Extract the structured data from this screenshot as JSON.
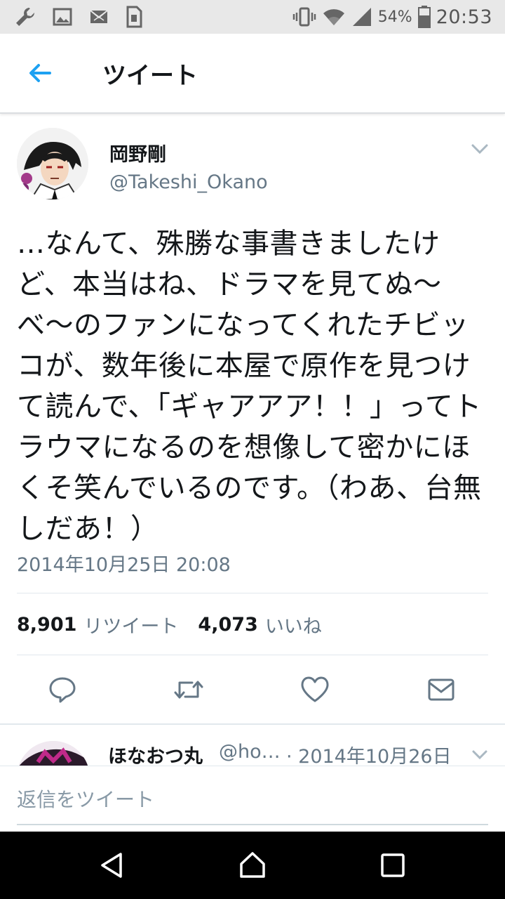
{
  "status_bar": {
    "battery_percent": "54%",
    "time": "20:53",
    "icons": [
      "wrench-icon",
      "image-icon",
      "mail-icon",
      "sim-icon",
      "vibrate-icon",
      "wifi-icon",
      "signal-icon",
      "battery-icon"
    ]
  },
  "header": {
    "title": "ツイート",
    "back_icon": "arrow-left-icon",
    "accent": "#1da1f2"
  },
  "tweet": {
    "author_name": "岡野剛",
    "author_handle": "@Takeshi_Okano",
    "text": "…なんて、殊勝な事書きましたけど、本当はね、ドラマを見てぬ〜べ〜のファンになってくれたチビッコが、数年後に本屋で原作を見つけて読んで、「ギャアアア！！」ってトラウマになるのを想像して密かにほくそ笑んでいるのです。（わあ、台無しだあ！）",
    "timestamp": "2014年10月25日 20:08",
    "retweets_count": "8,901",
    "retweets_label": "リツイート",
    "likes_count": "4,073",
    "likes_label": "いいね",
    "actions": [
      "reply-icon",
      "retweet-icon",
      "heart-icon",
      "share-mail-icon"
    ]
  },
  "reply_preview": {
    "name": "ほなおつ丸",
    "handle": "@ho…",
    "date": "· 2014年10月26日"
  },
  "compose": {
    "placeholder": "返信をツイート"
  },
  "nav_bar": {
    "buttons": [
      "back-triangle-icon",
      "home-icon",
      "recents-icon"
    ]
  }
}
